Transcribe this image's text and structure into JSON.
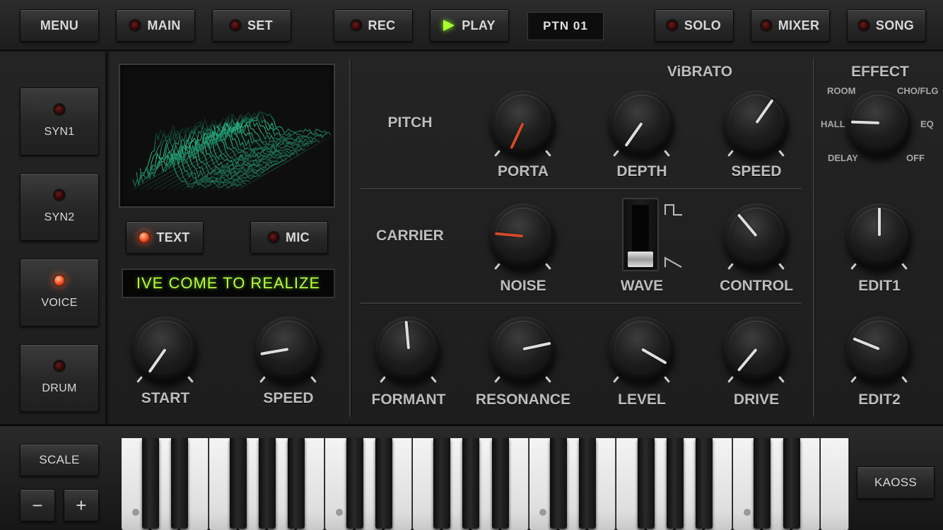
{
  "topbar": {
    "menu": "MENU",
    "main": "MAIN",
    "set": "SET",
    "rec": "REC",
    "play": "PLAY",
    "pattern": "PTN 01",
    "solo": "SOLO",
    "mixer": "MIXER",
    "song": "SONG"
  },
  "sidebar": {
    "items": [
      {
        "label": "SYN1",
        "active": false
      },
      {
        "label": "SYN2",
        "active": false
      },
      {
        "label": "VOICE",
        "active": true
      },
      {
        "label": "DRUM",
        "active": false
      }
    ]
  },
  "input": {
    "text_label": "TEXT",
    "text_active": true,
    "mic_label": "MIC",
    "mic_active": false,
    "lcd_text": "IVE COME TO REALIZE"
  },
  "left_knobs": {
    "start": "START",
    "speed": "SPEED"
  },
  "vibrato": {
    "title": "ViBRATO",
    "pitch": "PITCH",
    "porta": "PORTA",
    "depth": "DEPTH",
    "speed": "SPEED"
  },
  "carrier": {
    "title": "CARRIER",
    "noise": "NOISE",
    "wave": "WAVE",
    "control": "CONTROL"
  },
  "filter": {
    "formant": "FORMANT",
    "resonance": "RESONANCE",
    "level": "LEVEL",
    "drive": "DRIVE"
  },
  "effect": {
    "title": "EFFECT",
    "room": "ROOM",
    "cho_flg": "CHO/FLG",
    "hall": "HALL",
    "eq": "EQ",
    "delay": "DELAY",
    "off": "OFF",
    "edit1": "EDIT1",
    "edit2": "EDIT2"
  },
  "keyboard": {
    "scale": "SCALE",
    "minus": "−",
    "plus": "+",
    "kaoss": "KAOSS"
  },
  "colors": {
    "led_on": "#ff5a2a",
    "lcd_text": "#b6ff3a",
    "play_arrow": "#aaff2a",
    "knob_accent": "#d24a2a",
    "spectrum": "#2fd59a"
  }
}
